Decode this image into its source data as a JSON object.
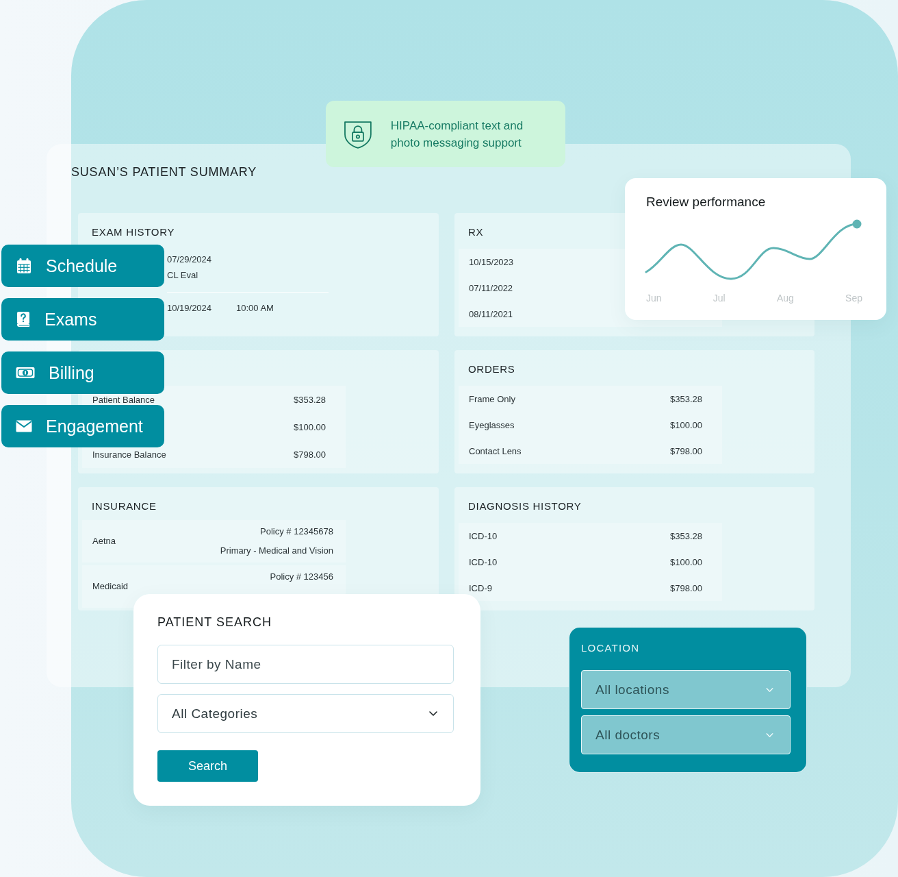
{
  "hipaa_banner": {
    "text": "HIPAA-compliant text and photo messaging support"
  },
  "summary": {
    "title": "SUSAN’S PATIENT SUMMARY",
    "exam_history": {
      "title": "EXAM HISTORY",
      "rows": [
        {
          "date": "07/29/2024",
          "detail": "CL Eval"
        },
        {
          "date": "10/19/2024",
          "time": "10:00 AM"
        }
      ]
    },
    "rx": {
      "title": "RX",
      "rows": [
        {
          "date": "10/15/2023"
        },
        {
          "date": "07/11/2022"
        },
        {
          "date": "08/11/2021"
        }
      ]
    },
    "balances": {
      "rows": [
        {
          "label": "Patient Balance",
          "value": "$353.28"
        },
        {
          "value": "$100.00"
        },
        {
          "label": "Insurance Balance",
          "value": "$798.00"
        }
      ]
    },
    "orders": {
      "title": "ORDERS",
      "rows": [
        {
          "label": "Frame Only",
          "value": "$353.28"
        },
        {
          "label": "Eyeglasses",
          "value": "$100.00"
        },
        {
          "label": "Contact Lens",
          "value": "$798.00"
        }
      ]
    },
    "insurance": {
      "title": "INSURANCE",
      "rows": [
        {
          "name": "Aetna",
          "lines": [
            "Policy # 12345678",
            "Primary - Medical and Vision"
          ]
        },
        {
          "name": "Medicaid",
          "lines": [
            "Policy # 123456"
          ]
        }
      ]
    },
    "diagnosis_history": {
      "title": "DIAGNOSIS HISTORY",
      "rows": [
        {
          "label": "ICD-10",
          "value": "$353.28"
        },
        {
          "label": "ICD-10",
          "value": "$100.00"
        },
        {
          "label": "ICD-9",
          "value": "$798.00"
        }
      ]
    }
  },
  "review_performance": {
    "title": "Review performance",
    "x_labels": [
      "Jun",
      "Jul",
      "Aug",
      "Sep"
    ]
  },
  "nav_buttons": [
    {
      "kind": "schedule",
      "label": "Schedule"
    },
    {
      "kind": "exams",
      "label": "Exams"
    },
    {
      "kind": "billing",
      "label": "Billing"
    },
    {
      "kind": "engagement",
      "label": "Engagement"
    }
  ],
  "patient_search": {
    "title": "PATIENT SEARCH",
    "name_filter": {
      "placeholder": "Filter by Name"
    },
    "category": {
      "value": "All Categories"
    },
    "button": "Search"
  },
  "location": {
    "title": "LOCATION",
    "selects": [
      {
        "value": "All locations"
      },
      {
        "value": "All doctors"
      }
    ]
  }
}
